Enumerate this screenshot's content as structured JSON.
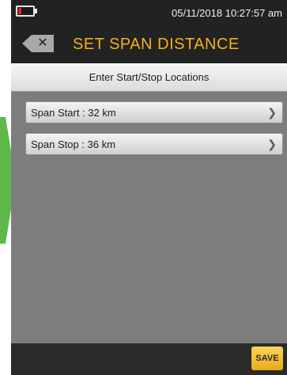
{
  "status_bar": {
    "datetime": "05/11/2018 10:27:57 am",
    "battery_icon": "battery-low-icon",
    "battery_color": "#e02020"
  },
  "header": {
    "title": "SET SPAN DISTANCE",
    "back_icon": "close-back-icon",
    "title_color": "#f3b21c"
  },
  "subheader": {
    "text": "Enter Start/Stop Locations"
  },
  "list": {
    "items": [
      {
        "label": "Span Start : 32 km",
        "icon": "chevron-right-icon"
      },
      {
        "label": "Span Stop : 36 km",
        "icon": "chevron-right-icon"
      }
    ]
  },
  "footer": {
    "save_label": "SAVE",
    "save_color": "#f3b21c"
  }
}
